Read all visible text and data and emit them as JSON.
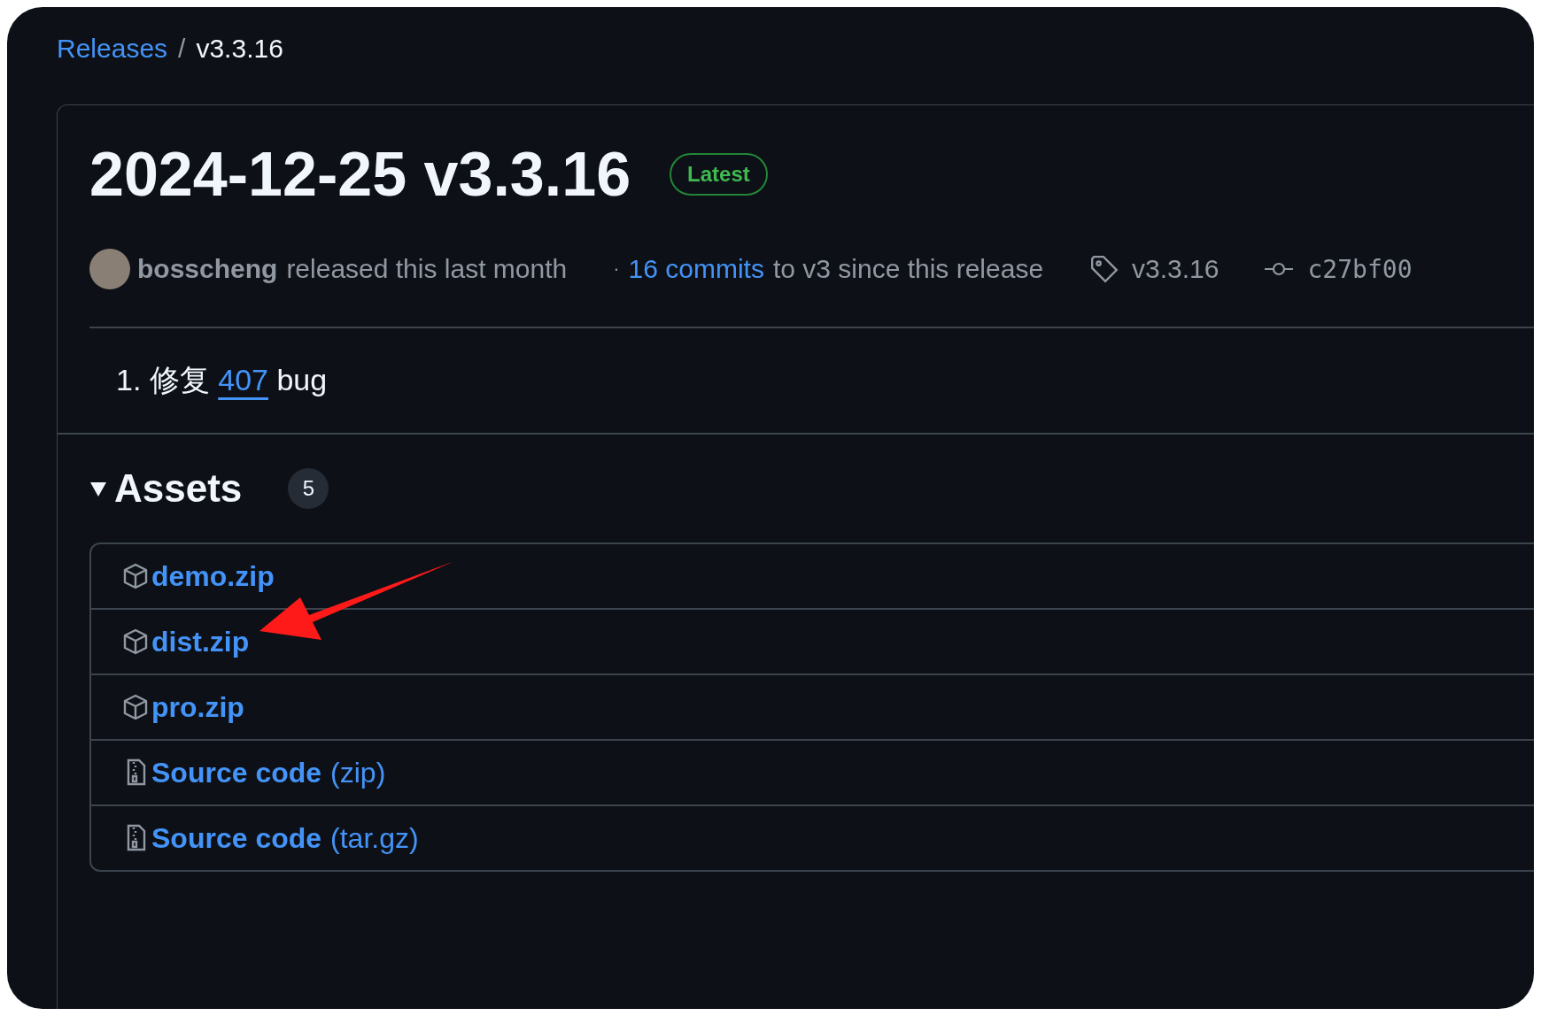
{
  "breadcrumb": {
    "parent": "Releases",
    "separator": "/",
    "current": "v3.3.16"
  },
  "release": {
    "title": "2024-12-25 v3.3.16",
    "badge": "Latest",
    "author": "bosscheng",
    "released_text": "released this last month",
    "commits_prefix": "·",
    "commits_link": "16 commits",
    "commits_suffix": "to v3 since this release",
    "tag": "v3.3.16",
    "commit": "c27bf00"
  },
  "notes": [
    {
      "number": "1.",
      "text": "修复",
      "link": "407",
      "after": "bug"
    }
  ],
  "assets": {
    "title": "Assets",
    "count": "5",
    "expanded": true,
    "items": [
      {
        "kind": "package",
        "name": "demo.zip"
      },
      {
        "kind": "package",
        "name": "dist.zip"
      },
      {
        "kind": "package",
        "name": "pro.zip"
      },
      {
        "kind": "source",
        "name": "Source code",
        "suffix": "(zip)"
      },
      {
        "kind": "source",
        "name": "Source code",
        "suffix": "(tar.gz)"
      }
    ]
  }
}
